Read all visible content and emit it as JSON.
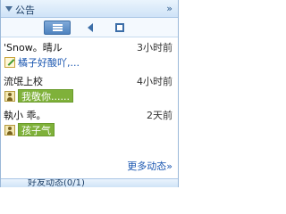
{
  "panel": {
    "title": "公告",
    "collapse_label": "»",
    "tabs": [
      {
        "name": "list",
        "icon": "list-icon",
        "active": true
      },
      {
        "name": "sound",
        "icon": "speaker-icon",
        "active": false
      },
      {
        "name": "box",
        "icon": "square-icon",
        "active": false
      }
    ]
  },
  "feed": [
    {
      "user": "'Snow。晴ル",
      "time": "3小时前",
      "status_icon": "pencil-icon",
      "status_text": "橘子好酸吖,...",
      "highlight": false
    },
    {
      "user": "流氓上校",
      "time": "4小时前",
      "status_icon": "person-icon",
      "status_text": "我敬你......",
      "highlight": true
    },
    {
      "user": "執小 乖。",
      "time": "2天前",
      "status_icon": "person-icon",
      "status_text": "孩子气",
      "highlight": true
    }
  ],
  "more": {
    "label": "更多动态»"
  },
  "next_section": {
    "label": "好友动态(0/1)"
  },
  "colors": {
    "accent": "#4e83bf",
    "link": "#1a56b0",
    "highlight": "#7fb13a"
  }
}
